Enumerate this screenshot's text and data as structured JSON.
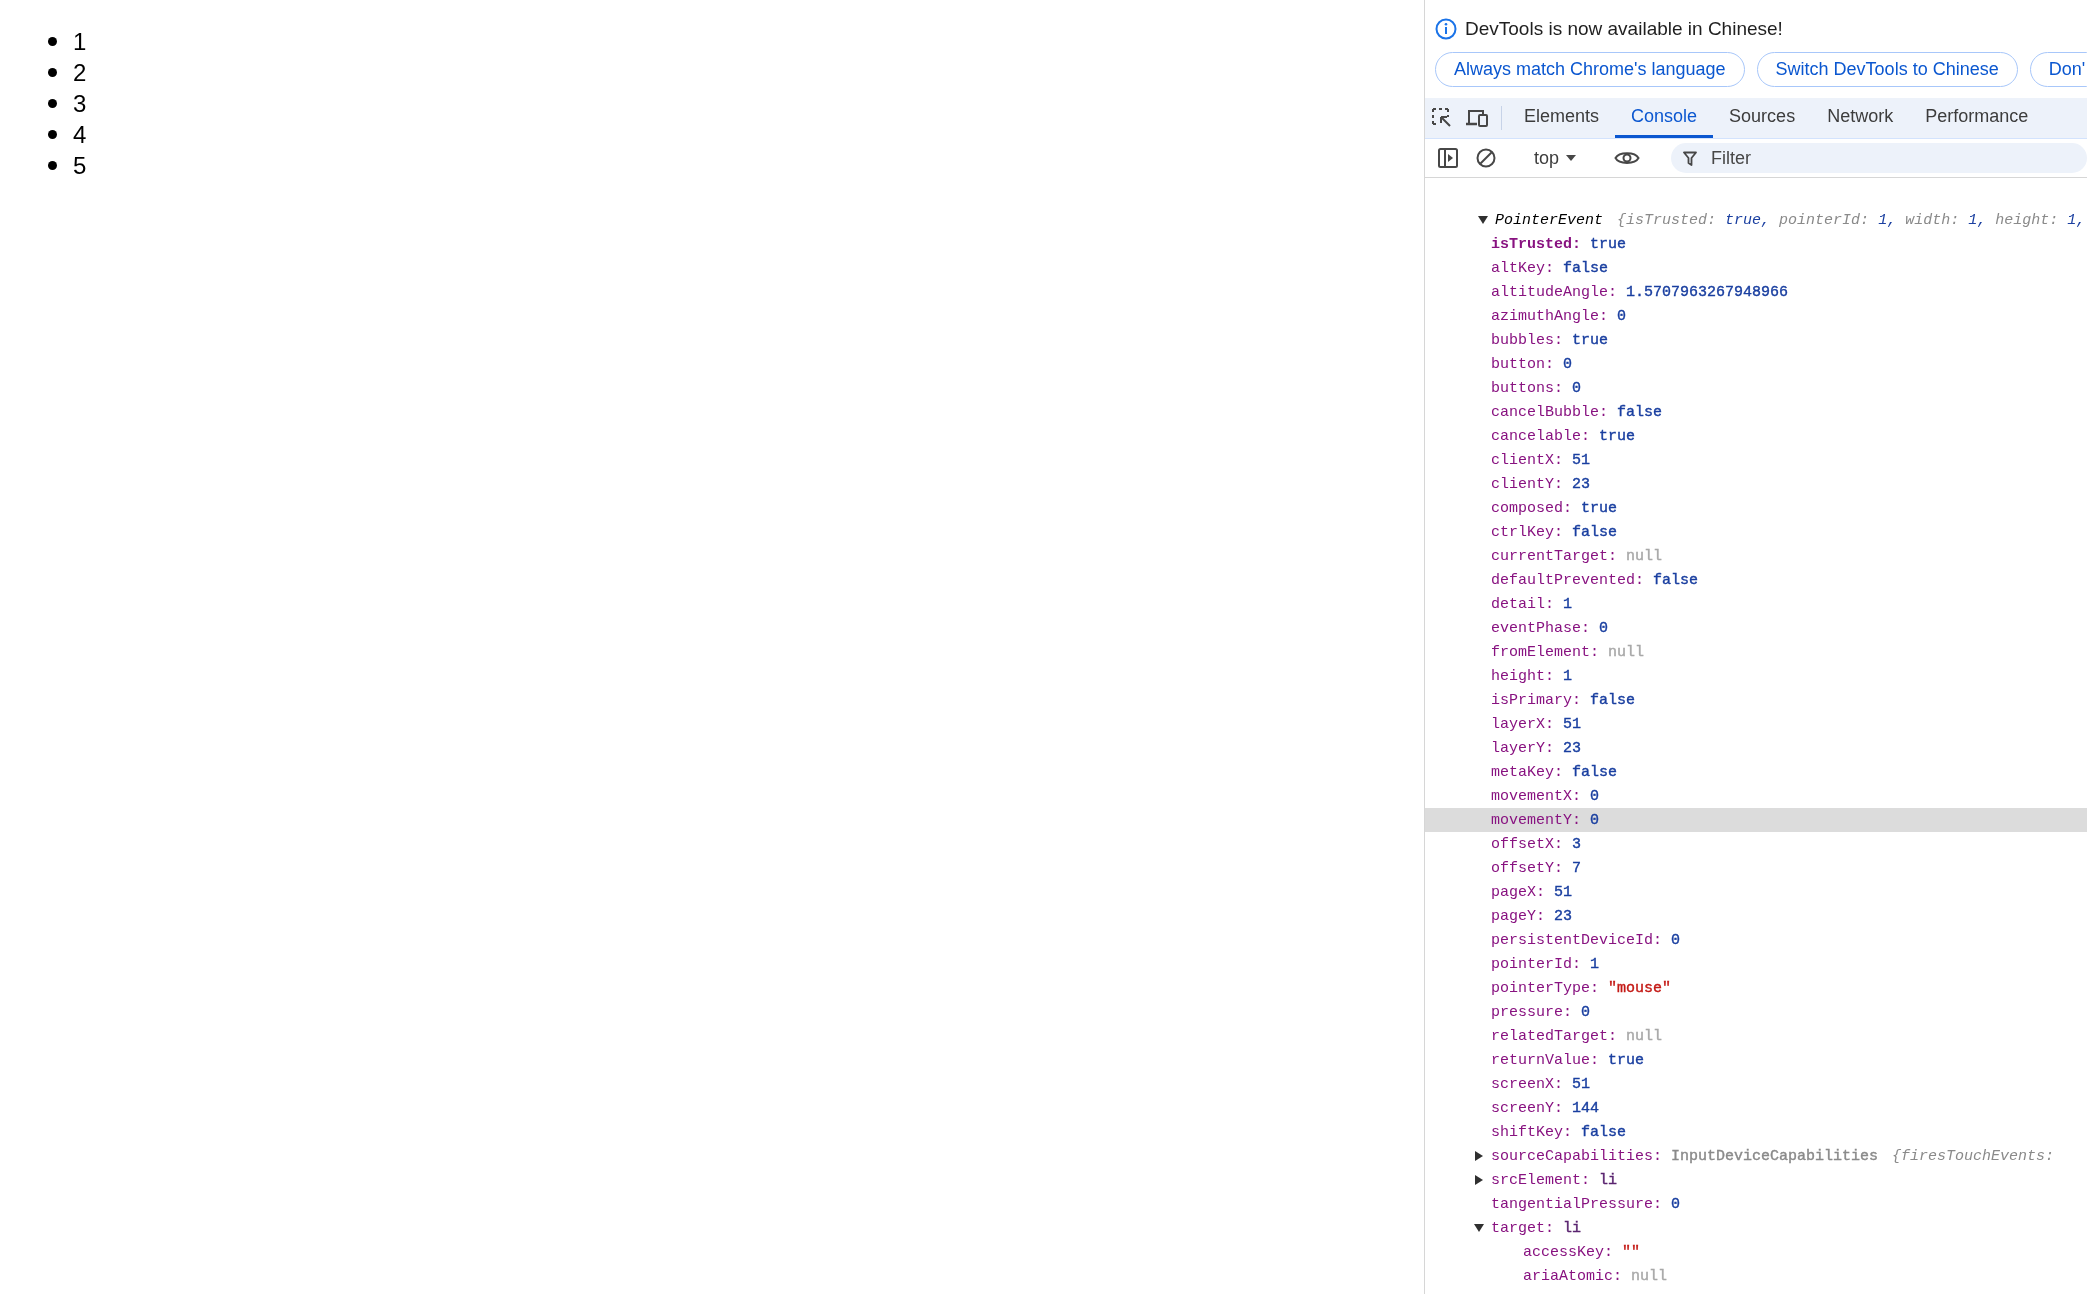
{
  "page": {
    "list_items": [
      "1",
      "2",
      "3",
      "4",
      "5"
    ]
  },
  "devtools": {
    "banner": {
      "message": "DevTools is now available in Chinese!",
      "buttons": [
        "Always match Chrome's language",
        "Switch DevTools to Chinese",
        "Don'"
      ]
    },
    "tabs": [
      {
        "label": "Elements",
        "selected": false
      },
      {
        "label": "Console",
        "selected": true
      },
      {
        "label": "Sources",
        "selected": false
      },
      {
        "label": "Network",
        "selected": false
      },
      {
        "label": "Performance",
        "selected": false
      }
    ],
    "toolbar": {
      "context": "top",
      "filter": {
        "placeholder": "Filter"
      }
    },
    "console": {
      "tree": {
        "kind": "node",
        "name": "PointerEvent",
        "expanded": true,
        "hovered": false,
        "bold": false,
        "preview": {
          "open": "{",
          "items": [
            {
              "key": "isTrusted:",
              "value": "true,"
            },
            {
              "key": "pointerId:",
              "value": "1,"
            },
            {
              "key": "width:",
              "value": "1,"
            },
            {
              "key": "height:",
              "value": "1,"
            }
          ]
        },
        "children": [
          {
            "kind": "leaf",
            "name": "isTrusted:",
            "value": "true",
            "color": "#1a3fa0",
            "hovered": false,
            "bold": true
          },
          {
            "kind": "leaf",
            "name": "altKey:",
            "value": "false",
            "color": "#1a3fa0",
            "hovered": false,
            "bold": false
          },
          {
            "kind": "leaf",
            "name": "altitudeAngle:",
            "value": "1.5707963267948966",
            "color": "#1a3fa0",
            "hovered": false,
            "bold": false
          },
          {
            "kind": "leaf",
            "name": "azimuthAngle:",
            "value": "0",
            "color": "#1a3fa0",
            "hovered": false,
            "bold": false
          },
          {
            "kind": "leaf",
            "name": "bubbles:",
            "value": "true",
            "color": "#1a3fa0",
            "hovered": false,
            "bold": false
          },
          {
            "kind": "leaf",
            "name": "button:",
            "value": "0",
            "color": "#1a3fa0",
            "hovered": false,
            "bold": false
          },
          {
            "kind": "leaf",
            "name": "buttons:",
            "value": "0",
            "color": "#1a3fa0",
            "hovered": false,
            "bold": false
          },
          {
            "kind": "leaf",
            "name": "cancelBubble:",
            "value": "false",
            "color": "#1a3fa0",
            "hovered": false,
            "bold": false
          },
          {
            "kind": "leaf",
            "name": "cancelable:",
            "value": "true",
            "color": "#1a3fa0",
            "hovered": false,
            "bold": false
          },
          {
            "kind": "leaf",
            "name": "clientX:",
            "value": "51",
            "color": "#1a3fa0",
            "hovered": false,
            "bold": false
          },
          {
            "kind": "leaf",
            "name": "clientY:",
            "value": "23",
            "color": "#1a3fa0",
            "hovered": false,
            "bold": false
          },
          {
            "kind": "leaf",
            "name": "composed:",
            "value": "true",
            "color": "#1a3fa0",
            "hovered": false,
            "bold": false
          },
          {
            "kind": "leaf",
            "name": "ctrlKey:",
            "value": "false",
            "color": "#1a3fa0",
            "hovered": false,
            "bold": false
          },
          {
            "kind": "leaf",
            "name": "currentTarget:",
            "value": "null",
            "color": "#a8a8a8",
            "hovered": false,
            "bold": false
          },
          {
            "kind": "leaf",
            "name": "defaultPrevented:",
            "value": "false",
            "color": "#1a3fa0",
            "hovered": false,
            "bold": false
          },
          {
            "kind": "leaf",
            "name": "detail:",
            "value": "1",
            "color": "#1a3fa0",
            "hovered": false,
            "bold": false
          },
          {
            "kind": "leaf",
            "name": "eventPhase:",
            "value": "0",
            "color": "#1a3fa0",
            "hovered": false,
            "bold": false
          },
          {
            "kind": "leaf",
            "name": "fromElement:",
            "value": "null",
            "color": "#a8a8a8",
            "hovered": false,
            "bold": false
          },
          {
            "kind": "leaf",
            "name": "height:",
            "value": "1",
            "color": "#1a3fa0",
            "hovered": false,
            "bold": false
          },
          {
            "kind": "leaf",
            "name": "isPrimary:",
            "value": "false",
            "color": "#1a3fa0",
            "hovered": false,
            "bold": false
          },
          {
            "kind": "leaf",
            "name": "layerX:",
            "value": "51",
            "color": "#1a3fa0",
            "hovered": false,
            "bold": false
          },
          {
            "kind": "leaf",
            "name": "layerY:",
            "value": "23",
            "color": "#1a3fa0",
            "hovered": false,
            "bold": false
          },
          {
            "kind": "leaf",
            "name": "metaKey:",
            "value": "false",
            "color": "#1a3fa0",
            "hovered": false,
            "bold": false
          },
          {
            "kind": "leaf",
            "name": "movementX:",
            "value": "0",
            "color": "#1a3fa0",
            "hovered": false,
            "bold": false
          },
          {
            "kind": "leaf",
            "name": "movementY:",
            "value": "0",
            "color": "#1a3fa0",
            "hovered": true,
            "bold": false
          },
          {
            "kind": "leaf",
            "name": "offsetX:",
            "value": "3",
            "color": "#1a3fa0",
            "hovered": false,
            "bold": false
          },
          {
            "kind": "leaf",
            "name": "offsetY:",
            "value": "7",
            "color": "#1a3fa0",
            "hovered": false,
            "bold": false
          },
          {
            "kind": "leaf",
            "name": "pageX:",
            "value": "51",
            "color": "#1a3fa0",
            "hovered": false,
            "bold": false
          },
          {
            "kind": "leaf",
            "name": "pageY:",
            "value": "23",
            "color": "#1a3fa0",
            "hovered": false,
            "bold": false
          },
          {
            "kind": "leaf",
            "name": "persistentDeviceId:",
            "value": "0",
            "color": "#1a3fa0",
            "hovered": false,
            "bold": false
          },
          {
            "kind": "leaf",
            "name": "pointerId:",
            "value": "1",
            "color": "#1a3fa0",
            "hovered": false,
            "bold": false
          },
          {
            "kind": "leaf",
            "name": "pointerType:",
            "value": "\"mouse\"",
            "color": "#c41a16",
            "hovered": false,
            "bold": false
          },
          {
            "kind": "leaf",
            "name": "pressure:",
            "value": "0",
            "color": "#1a3fa0",
            "hovered": false,
            "bold": false
          },
          {
            "kind": "leaf",
            "name": "relatedTarget:",
            "value": "null",
            "color": "#a8a8a8",
            "hovered": false,
            "bold": false
          },
          {
            "kind": "leaf",
            "name": "returnValue:",
            "value": "true",
            "color": "#1a3fa0",
            "hovered": false,
            "bold": false
          },
          {
            "kind": "leaf",
            "name": "screenX:",
            "value": "51",
            "color": "#1a3fa0",
            "hovered": false,
            "bold": false
          },
          {
            "kind": "leaf",
            "name": "screenY:",
            "value": "144",
            "color": "#1a3fa0",
            "hovered": false,
            "bold": false
          },
          {
            "kind": "leaf",
            "name": "shiftKey:",
            "value": "false",
            "color": "#1a3fa0",
            "hovered": false,
            "bold": false
          },
          {
            "kind": "node",
            "name": "sourceCapabilities:",
            "value": "InputDeviceCapabilities",
            "color": "#8a8a8a",
            "expanded": false,
            "hovered": false,
            "bold": false,
            "preview": {
              "open": "{",
              "items": [
                {
                  "key": "firesTouchEvents:"
                }
              ]
            }
          },
          {
            "kind": "node",
            "name": "srcElement:",
            "value": "li",
            "color": "#5a2470",
            "expanded": false,
            "hovered": false,
            "bold": false
          },
          {
            "kind": "leaf",
            "name": "tangentialPressure:",
            "value": "0",
            "color": "#1a3fa0",
            "hovered": false,
            "bold": false
          },
          {
            "kind": "node",
            "name": "target:",
            "value": "li",
            "color": "#5a2470",
            "expanded": true,
            "hovered": false,
            "bold": false,
            "children": [
              {
                "kind": "leaf",
                "name": "accessKey:",
                "value": "\"\"",
                "color": "#c41a16",
                "hovered": false,
                "bold": false
              },
              {
                "kind": "leaf",
                "name": "ariaAtomic:",
                "value": "null",
                "color": "#a8a8a8",
                "hovered": false,
                "bold": false
              }
            ]
          }
        ]
      }
    }
  }
}
